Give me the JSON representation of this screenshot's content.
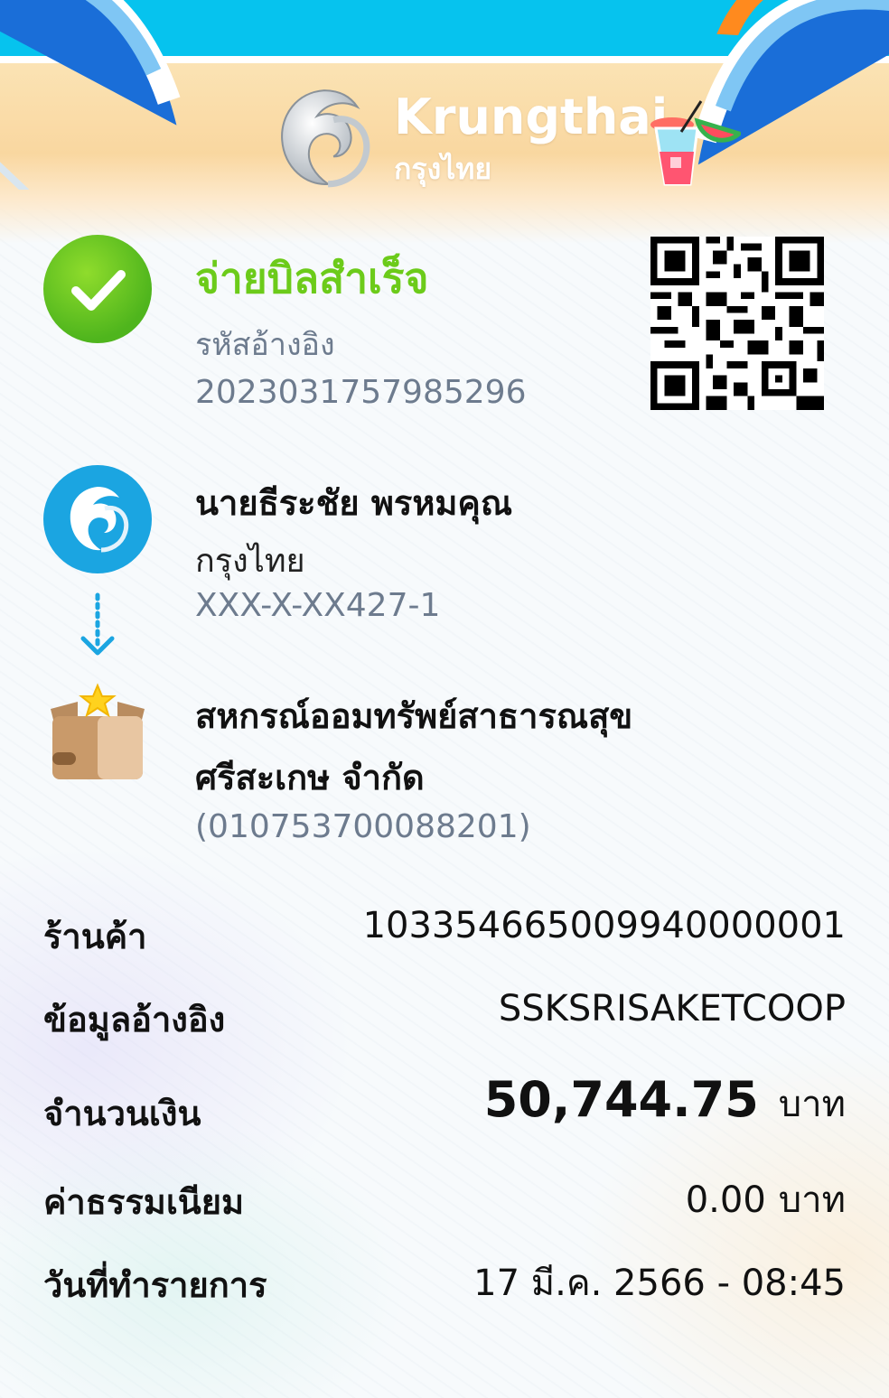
{
  "brand": {
    "name_en": "Krungthai",
    "name_th": "กรุงไทย"
  },
  "status": {
    "title": "จ่ายบิลสำเร็จ",
    "reference_label": "รหัสอ้างอิง",
    "reference_value": "2023031757985296"
  },
  "sender": {
    "name": "นายธีระชัย พรหมคุณ",
    "bank": "กรุงไทย",
    "account": "XXX-X-XX427-1"
  },
  "biller": {
    "name_line1": "สหกรณ์ออมทรัพย์สาธารณสุข",
    "name_line2": "ศรีสะเกษ จำกัด",
    "tax_id": "(010753700088201)"
  },
  "details": {
    "store_label": "ร้านค้า",
    "store_value": "103354665009940000001",
    "info_label": "ข้อมูลอ้างอิง",
    "info_value": "SSKSRISAKETCOOP",
    "amount_label": "จำนวนเงิน",
    "amount_value": "50,744.75",
    "amount_unit": "บาท",
    "fee_label": "ค่าธรรมเนียม",
    "fee_value": "0.00",
    "fee_unit": "บาท",
    "date_label": "วันที่ทำรายการ",
    "date_value": "17 มี.ค. 2566 - 08:45"
  },
  "icons": {
    "success": "check-circle-icon",
    "qr": "qr-code-icon",
    "bank": "krungthai-logo-icon",
    "biller": "gift-box-star-icon",
    "flow": "dotted-arrow-down-icon",
    "drink": "summer-drink-icon",
    "umbrella": "beach-umbrella-icon"
  },
  "colors": {
    "success_green": "#6ccb1a",
    "brand_blue": "#1ba5e1",
    "muted_text": "#6d7b8e",
    "sky": "#06c3ee",
    "sand": "#f9d7a0"
  }
}
